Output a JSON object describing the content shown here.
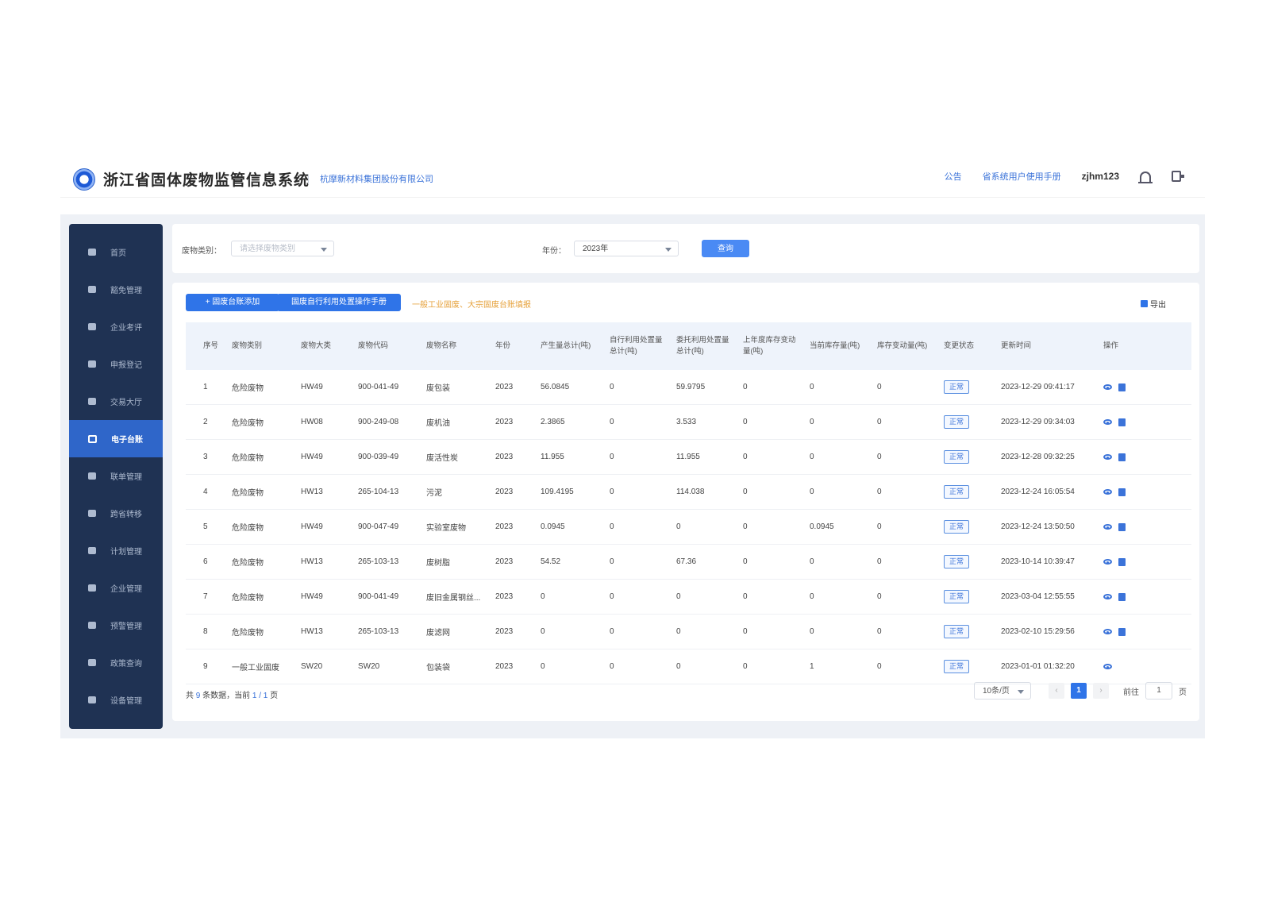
{
  "header": {
    "title": "浙江省固体废物监管信息系统",
    "company": "杭摩新材料集团股份有限公司",
    "announcement": "公告",
    "manual": "省系统用户使用手册",
    "username": "zjhm123"
  },
  "sidebar": {
    "items": [
      {
        "label": "首页",
        "icon": "home-icon"
      },
      {
        "label": "豁免管理",
        "icon": "shield-icon"
      },
      {
        "label": "企业考评",
        "icon": "chat-icon"
      },
      {
        "label": "申报登记",
        "icon": "document-icon"
      },
      {
        "label": "交易大厅",
        "icon": "store-icon"
      },
      {
        "label": "电子台账",
        "icon": "ledger-icon",
        "active": true
      },
      {
        "label": "联单管理",
        "icon": "file-icon"
      },
      {
        "label": "跨省转移",
        "icon": "transfer-icon"
      },
      {
        "label": "计划管理",
        "icon": "camera-icon"
      },
      {
        "label": "企业管理",
        "icon": "building-icon"
      },
      {
        "label": "预警管理",
        "icon": "alert-icon"
      },
      {
        "label": "政策查询",
        "icon": "book-icon"
      },
      {
        "label": "设备管理",
        "icon": "device-icon"
      }
    ]
  },
  "filter": {
    "waste_type_label": "废物类别：",
    "waste_type_placeholder": "请选择废物类别",
    "year_label": "年份：",
    "year_value": "2023年",
    "query_label": "查询"
  },
  "toolbar": {
    "add_label": "+ 固废台账添加",
    "manual_label": "固废自行利用处置操作手册",
    "notice": "一般工业固废、大宗固废台账填报",
    "export_label": "导出"
  },
  "table": {
    "columns": [
      "序号",
      "废物类别",
      "废物大类",
      "废物代码",
      "废物名称",
      "年份",
      "产生量总计(吨)",
      "自行利用处置量总计(吨)",
      "委托利用处置量总计(吨)",
      "上年度库存变动量(吨)",
      "当前库存量(吨)",
      "库存变动量(吨)",
      "变更状态",
      "更新时间",
      "操作"
    ],
    "rows": [
      {
        "no": "1",
        "category": "危险废物",
        "class": "HW49",
        "code": "900-041-49",
        "name": "废包装",
        "year": "2023",
        "produce": "56.0845",
        "self": "0",
        "entrust": "59.9795",
        "last": "0",
        "stock": "0",
        "change": "0",
        "status": "正常",
        "updated": "2023-12-29 09:41:17",
        "edit": true
      },
      {
        "no": "2",
        "category": "危险废物",
        "class": "HW08",
        "code": "900-249-08",
        "name": "废机油",
        "year": "2023",
        "produce": "2.3865",
        "self": "0",
        "entrust": "3.533",
        "last": "0",
        "stock": "0",
        "change": "0",
        "status": "正常",
        "updated": "2023-12-29 09:34:03",
        "edit": true
      },
      {
        "no": "3",
        "category": "危险废物",
        "class": "HW49",
        "code": "900-039-49",
        "name": "废活性炭",
        "year": "2023",
        "produce": "11.955",
        "self": "0",
        "entrust": "11.955",
        "last": "0",
        "stock": "0",
        "change": "0",
        "status": "正常",
        "updated": "2023-12-28 09:32:25",
        "edit": true
      },
      {
        "no": "4",
        "category": "危险废物",
        "class": "HW13",
        "code": "265-104-13",
        "name": "污泥",
        "year": "2023",
        "produce": "109.4195",
        "self": "0",
        "entrust": "114.038",
        "last": "0",
        "stock": "0",
        "change": "0",
        "status": "正常",
        "updated": "2023-12-24 16:05:54",
        "edit": true
      },
      {
        "no": "5",
        "category": "危险废物",
        "class": "HW49",
        "code": "900-047-49",
        "name": "实验室废物",
        "year": "2023",
        "produce": "0.0945",
        "self": "0",
        "entrust": "0",
        "last": "0",
        "stock": "0.0945",
        "change": "0",
        "status": "正常",
        "updated": "2023-12-24 13:50:50",
        "edit": true
      },
      {
        "no": "6",
        "category": "危险废物",
        "class": "HW13",
        "code": "265-103-13",
        "name": "废树脂",
        "year": "2023",
        "produce": "54.52",
        "self": "0",
        "entrust": "67.36",
        "last": "0",
        "stock": "0",
        "change": "0",
        "status": "正常",
        "updated": "2023-10-14 10:39:47",
        "edit": true
      },
      {
        "no": "7",
        "category": "危险废物",
        "class": "HW49",
        "code": "900-041-49",
        "name": "废旧金属钢丝...",
        "year": "2023",
        "produce": "0",
        "self": "0",
        "entrust": "0",
        "last": "0",
        "stock": "0",
        "change": "0",
        "status": "正常",
        "updated": "2023-03-04 12:55:55",
        "edit": true
      },
      {
        "no": "8",
        "category": "危险废物",
        "class": "HW13",
        "code": "265-103-13",
        "name": "废滤网",
        "year": "2023",
        "produce": "0",
        "self": "0",
        "entrust": "0",
        "last": "0",
        "stock": "0",
        "change": "0",
        "status": "正常",
        "updated": "2023-02-10 15:29:56",
        "edit": true
      },
      {
        "no": "9",
        "category": "一般工业固废",
        "class": "SW20",
        "code": "SW20",
        "name": "包装袋",
        "year": "2023",
        "produce": "0",
        "self": "0",
        "entrust": "0",
        "last": "0",
        "stock": "1",
        "change": "0",
        "status": "正常",
        "updated": "2023-01-01 01:32:20",
        "edit": false
      }
    ]
  },
  "footer": {
    "prefix": "共",
    "total": "9",
    "mid": "条数据，当前",
    "page": "1 / 1",
    "suffix": "页",
    "page_size": "10条/页",
    "current_page": "1",
    "goto_label": "前往",
    "goto_value": "1",
    "goto_suffix": "页"
  }
}
